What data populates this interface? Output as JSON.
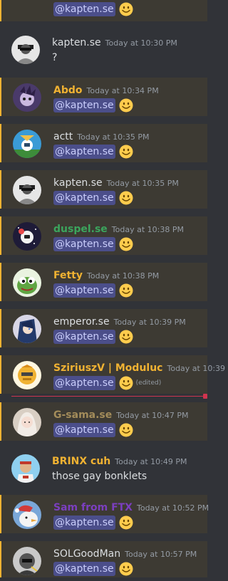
{
  "messages": [
    {
      "id": "m0",
      "avatar": "none",
      "username": "",
      "timestamp": "",
      "mention": "@kapten.se",
      "emoji": "slightly-smiling-face",
      "highlighted": true,
      "edited": ""
    },
    {
      "id": "m1",
      "avatar": "kapten",
      "username": "kapten.se",
      "name_color": "#dbdee1",
      "timestamp": "Today at 10:30 PM",
      "text": "?",
      "highlighted": false
    },
    {
      "id": "m2",
      "avatar": "abdo",
      "username": "Abdo",
      "name_color": "#f0b232",
      "timestamp": "Today at 10:34 PM",
      "mention": "@kapten.se",
      "emoji": "slightly-smiling-face",
      "highlighted": true
    },
    {
      "id": "m3",
      "avatar": "actt",
      "username": "actt",
      "name_color": "#dbdee1",
      "timestamp": "Today at 10:35 PM",
      "mention": "@kapten.se",
      "emoji": "slightly-smiling-face",
      "highlighted": true
    },
    {
      "id": "m4",
      "avatar": "kapten",
      "username": "kapten.se",
      "name_color": "#dbdee1",
      "timestamp": "Today at 10:35 PM",
      "mention": "@kapten.se",
      "emoji": "slightly-smiling-face",
      "highlighted": true
    },
    {
      "id": "m5",
      "avatar": "duspel",
      "username": "duspel.se",
      "name_color": "#3ba55d",
      "timestamp": "Today at 10:38 PM",
      "mention": "@kapten.se",
      "emoji": "slightly-smiling-face",
      "highlighted": true
    },
    {
      "id": "m6",
      "avatar": "fetty",
      "username": "Fetty",
      "name_color": "#f0b232",
      "timestamp": "Today at 10:38 PM",
      "mention": "@kapten.se",
      "emoji": "slightly-smiling-face",
      "highlighted": true
    },
    {
      "id": "m7",
      "avatar": "emperor",
      "username": "emperor.se",
      "name_color": "#dbdee1",
      "timestamp": "Today at 10:39 PM",
      "mention": "@kapten.se",
      "emoji": "slightly-smiling-face",
      "highlighted": true
    },
    {
      "id": "m8",
      "avatar": "sziriusz",
      "username": "SziriuszV | Moduluc",
      "name_color": "#f0b232",
      "timestamp": "Today at 10:39",
      "mention": "@kapten.se",
      "emoji": "slightly-smiling-face",
      "highlighted": true,
      "edited": "(edited)"
    },
    {
      "id": "m9",
      "avatar": "gsama",
      "username": "G-sama.se",
      "name_color": "#a38c5a",
      "timestamp": "Today at 10:47 PM",
      "mention": "@kapten.se",
      "emoji": "slightly-smiling-face",
      "highlighted": true
    },
    {
      "id": "m10",
      "avatar": "brinx",
      "username": "BRINX cuh",
      "name_color": "#f0b232",
      "timestamp": "Today at 10:49 PM",
      "text": "those gay bonklets",
      "highlighted": false
    },
    {
      "id": "m11",
      "avatar": "sam",
      "username": "Sam from FTX",
      "name_color": "#7b3fbf",
      "timestamp": "Today at 10:52 PM",
      "mention": "@kapten.se",
      "emoji": "slightly-smiling-face",
      "highlighted": true
    },
    {
      "id": "m12",
      "avatar": "solgood",
      "username": "SOLGoodMan",
      "name_color": "#dbdee1",
      "timestamp": "Today at 10:57 PM",
      "mention": "@kapten.se",
      "emoji": "slightly-smiling-face",
      "highlighted": true
    }
  ],
  "new_messages_divider": "unread-divider",
  "colors": {
    "background": "#313338",
    "mention_bg": "#3d3a33",
    "mention_bar": "#f0b232",
    "pill_bg": "#4b4e8a",
    "pill_text": "#c9cdfb",
    "timestamp": "#949ba4",
    "divider": "#d0344e"
  }
}
